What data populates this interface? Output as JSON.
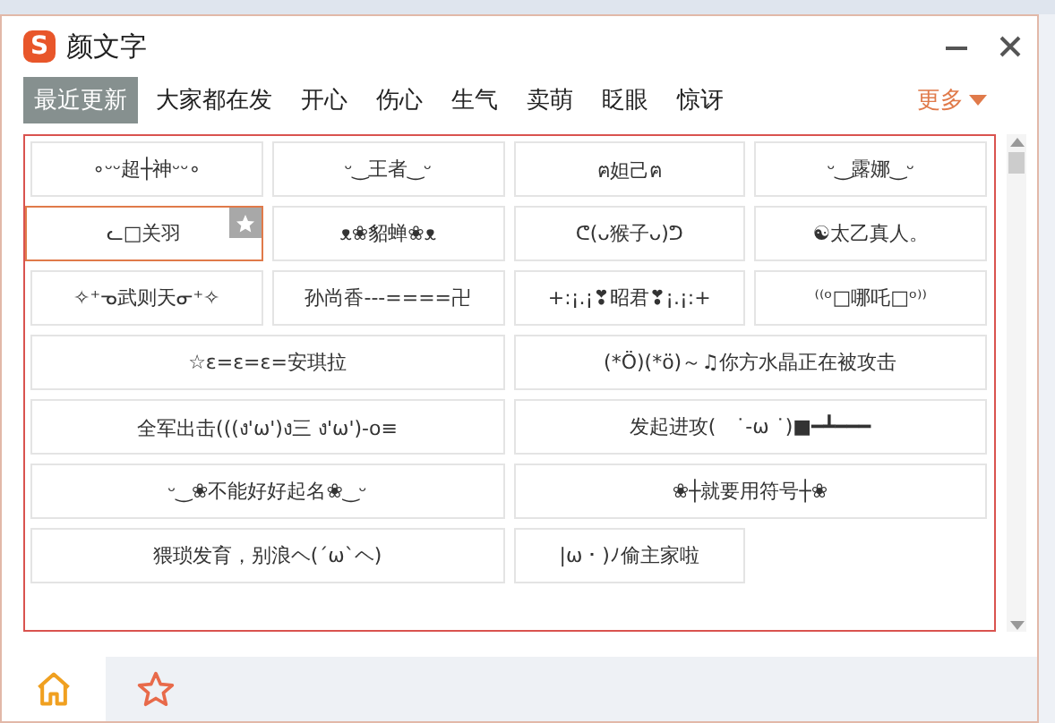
{
  "window": {
    "logo": "S",
    "title": "颜文字"
  },
  "tabs": [
    {
      "label": "最近更新",
      "selected": true
    },
    {
      "label": "大家都在发",
      "selected": false
    },
    {
      "label": "开心",
      "selected": false
    },
    {
      "label": "伤心",
      "selected": false
    },
    {
      "label": "生气",
      "selected": false
    },
    {
      "label": "卖萌",
      "selected": false
    },
    {
      "label": "眨眼",
      "selected": false
    },
    {
      "label": "惊讶",
      "selected": false
    }
  ],
  "more": {
    "label": "更多"
  },
  "items": [
    {
      "text": "∘ᵕᵕ超┼神ᵕᵕ∘",
      "kind": "narrow",
      "selected": false
    },
    {
      "text": "ᵕ‿王者‿ᵕ",
      "kind": "narrow",
      "selected": false
    },
    {
      "text": "ฅ妲己ฅ",
      "kind": "narrow",
      "selected": false
    },
    {
      "text": "ᵕ‿露娜‿ᵕ",
      "kind": "narrow",
      "selected": false
    },
    {
      "text": "ᓚ□关羽",
      "kind": "narrow",
      "selected": true
    },
    {
      "text": "ᴥ❀貂蝉❀ᴥ",
      "kind": "narrow",
      "selected": false
    },
    {
      "text": "ᕦ(ᴗ猴子ᴗ)ᕤ",
      "kind": "narrow",
      "selected": false
    },
    {
      "text": "☯太乙真人。",
      "kind": "narrow",
      "selected": false
    },
    {
      "text": "✧⁺ᓀ武则天ᓂ⁺✧",
      "kind": "narrow",
      "selected": false
    },
    {
      "text": "孙尚香---====卍",
      "kind": "narrow",
      "selected": false
    },
    {
      "text": "+:¡.¡❣昭君❣¡.¡:+",
      "kind": "narrow",
      "selected": false
    },
    {
      "text": "⁽⁽ᵒ□哪吒□ᵒ⁾⁾",
      "kind": "narrow",
      "selected": false
    },
    {
      "text": "☆ε=ε=ε=安琪拉",
      "kind": "wide",
      "selected": false
    },
    {
      "text": "(*Ö)(*ö)～♫你方水晶正在被攻击",
      "kind": "wide",
      "selected": false
    },
    {
      "text": "全军出击(((ง'ω')ง三 ง'ω')-o≡",
      "kind": "wide",
      "selected": false
    },
    {
      "text": "发起进攻(　˙-ω ˙)■━┻━━━",
      "kind": "wide",
      "selected": false
    },
    {
      "text": "ᵕ‿❀不能好好起名❀‿ᵕ",
      "kind": "wide",
      "selected": false
    },
    {
      "text": "❀┼就要用符号┼❀",
      "kind": "wide",
      "selected": false
    },
    {
      "text": "猥琐发育，别浪ヘ(´ω`ヘ)",
      "kind": "wide",
      "selected": false
    },
    {
      "text": "|ω・)ﾉ偷主家啦",
      "kind": "narrow",
      "selected": false
    }
  ],
  "bottom_tabs": [
    {
      "kind": "home",
      "selected": true
    },
    {
      "kind": "favorites",
      "selected": false
    }
  ]
}
